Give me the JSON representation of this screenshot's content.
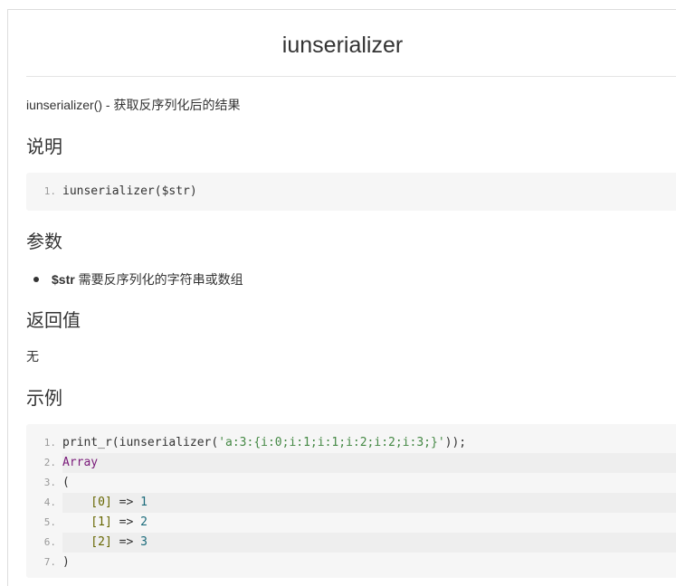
{
  "title": "iunserializer",
  "intro": "iunserializer() - 获取反序列化后的结果",
  "sections": {
    "description": {
      "heading": "说明"
    },
    "params": {
      "heading": "参数",
      "items": [
        {
          "name": "$str",
          "desc": " 需要反序列化的字符串或数组"
        }
      ]
    },
    "returns": {
      "heading": "返回值",
      "text": "无"
    },
    "example": {
      "heading": "示例"
    }
  },
  "description_code": {
    "lines": [
      {
        "num": "1.",
        "text": "iunserializer($str)"
      }
    ]
  },
  "example_code": {
    "lines": [
      {
        "num": "1.",
        "parts": [
          {
            "t": "print_r(iunserializer(",
            "c": "plain"
          },
          {
            "t": "'a:3:{i:0;i:1;i:1;i:2;i:2;i:3;}'",
            "c": "str"
          },
          {
            "t": "));",
            "c": "plain"
          }
        ]
      },
      {
        "num": "2.",
        "parts": [
          {
            "t": "Array",
            "c": "kw"
          }
        ]
      },
      {
        "num": "3.",
        "parts": [
          {
            "t": "(",
            "c": "plain"
          }
        ]
      },
      {
        "num": "4.",
        "parts": [
          {
            "t": "    [0] ",
            "c": "brk"
          },
          {
            "t": "=>",
            "c": "plain"
          },
          {
            "t": " 1",
            "c": "num"
          }
        ]
      },
      {
        "num": "5.",
        "parts": [
          {
            "t": "    [1] ",
            "c": "brk"
          },
          {
            "t": "=>",
            "c": "plain"
          },
          {
            "t": " 2",
            "c": "num"
          }
        ]
      },
      {
        "num": "6.",
        "parts": [
          {
            "t": "    [2] ",
            "c": "brk"
          },
          {
            "t": "=>",
            "c": "plain"
          },
          {
            "t": " 3",
            "c": "num"
          }
        ]
      },
      {
        "num": "7.",
        "parts": [
          {
            "t": ")",
            "c": "plain"
          }
        ]
      }
    ]
  },
  "colors": {
    "code_bg": "#f6f6f6",
    "alt_line_bg": "#eeeeee",
    "string": "#448844",
    "keyword": "#7a1a7a",
    "number": "#1a6a7a"
  }
}
